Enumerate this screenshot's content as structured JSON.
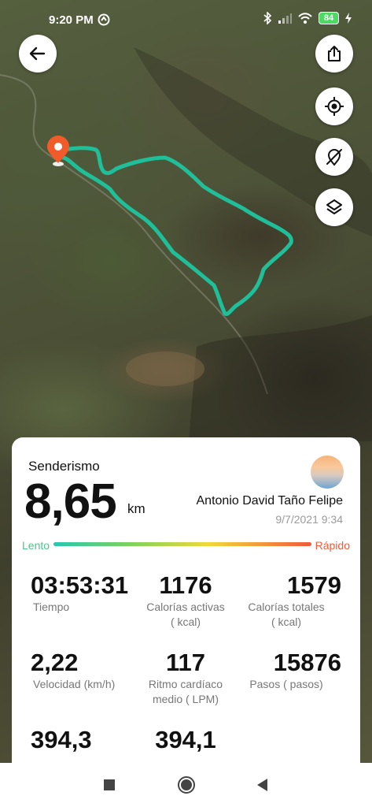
{
  "status_bar": {
    "time": "9:20 PM",
    "battery": "84",
    "icons": [
      "app-notification-icon",
      "bluetooth-icon",
      "signal-icon",
      "wifi-icon",
      "battery-icon",
      "charging-icon"
    ]
  },
  "map_controls": {
    "back": "arrow-left-icon",
    "share": "share-icon",
    "locate": "locate-icon",
    "hide_route": "route-off-icon",
    "layers": "layers-icon"
  },
  "colors": {
    "route": "#1fbf9a",
    "marker": "#f15a2b",
    "slow": "#4ec58b",
    "fast": "#f15a3b"
  },
  "summary": {
    "activity": "Senderismo",
    "distance": "8,65",
    "distance_unit": "km",
    "user_name": "Antonio David Taño Felipe",
    "date": "9/7/2021 9:34",
    "slow_label": "Lento",
    "fast_label": "Rápido"
  },
  "stats": {
    "duration": {
      "value": "03:53:31",
      "label": "Tiempo"
    },
    "active_calories": {
      "value": "1176",
      "label": "Calorías activas",
      "unit": "( kcal)"
    },
    "total_calories": {
      "value": "1579",
      "label": "Calorías totales",
      "unit": "( kcal)"
    },
    "speed": {
      "value": "2,22",
      "label": "Velocidad (km/h)"
    },
    "heart_rate": {
      "value": "117",
      "label": "Ritmo cardíaco",
      "unit": "medio ( LPM)"
    },
    "steps": {
      "value": "15876",
      "label": "Pasos ( pasos)"
    },
    "extra_1": {
      "value": "394,3"
    },
    "extra_2": {
      "value": "394,1"
    }
  },
  "nav_bar": {
    "recents": "square-icon",
    "home": "circle-icon",
    "back": "triangle-back-icon"
  }
}
